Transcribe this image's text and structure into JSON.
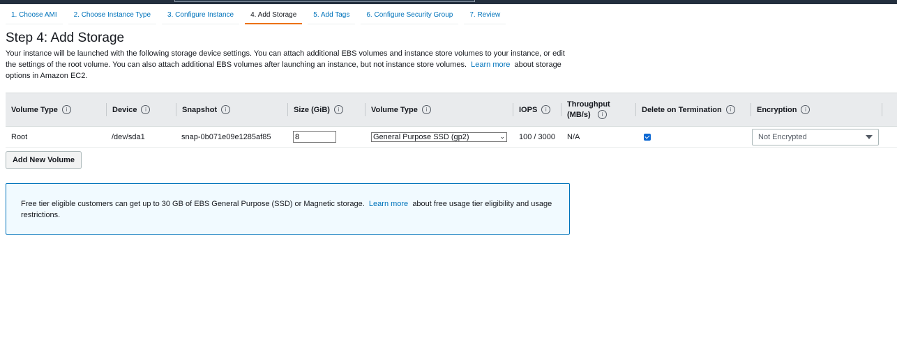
{
  "wizard": {
    "tabs": [
      {
        "label": "1. Choose AMI"
      },
      {
        "label": "2. Choose Instance Type"
      },
      {
        "label": "3. Configure Instance"
      },
      {
        "label": "4. Add Storage"
      },
      {
        "label": "5. Add Tags"
      },
      {
        "label": "6. Configure Security Group"
      },
      {
        "label": "7. Review"
      }
    ],
    "active_index": 3
  },
  "page": {
    "title": "Step 4: Add Storage",
    "intro_text": "Your instance will be launched with the following storage device settings. You can attach additional EBS volumes and instance store volumes to your instance, or edit the settings of the root volume. You can also attach additional EBS volumes after launching an instance, but not instance store volumes.",
    "intro_link": "Learn more",
    "intro_suffix": "about storage options in Amazon EC2."
  },
  "table": {
    "headers": {
      "volume_type": "Volume Type",
      "device": "Device",
      "snapshot": "Snapshot",
      "size": "Size (GiB)",
      "volume_type2": "Volume Type",
      "iops": "IOPS",
      "throughput": "Throughput (MB/s)",
      "delete": "Delete on Termination",
      "encryption": "Encryption"
    },
    "info_glyph": "i",
    "row": {
      "volume_type": "Root",
      "device": "/dev/sda1",
      "snapshot": "snap-0b071e09e1285af85",
      "size": "8",
      "volume_type_select": "General Purpose SSD (gp2)",
      "iops": "100 / 3000",
      "throughput": "N/A",
      "delete_on_termination": true,
      "encryption": "Not Encrypted"
    }
  },
  "buttons": {
    "add_new_volume": "Add New Volume"
  },
  "notice": {
    "text": "Free tier eligible customers can get up to 30 GB of EBS General Purpose (SSD) or Magnetic storage.",
    "link": "Learn more",
    "suffix": "about free usage tier eligibility and usage restrictions."
  },
  "colors": {
    "accent": "#ec7211",
    "link": "#0073bb",
    "checkbox": "#0b67d2",
    "notice_bg": "#f1faff"
  }
}
